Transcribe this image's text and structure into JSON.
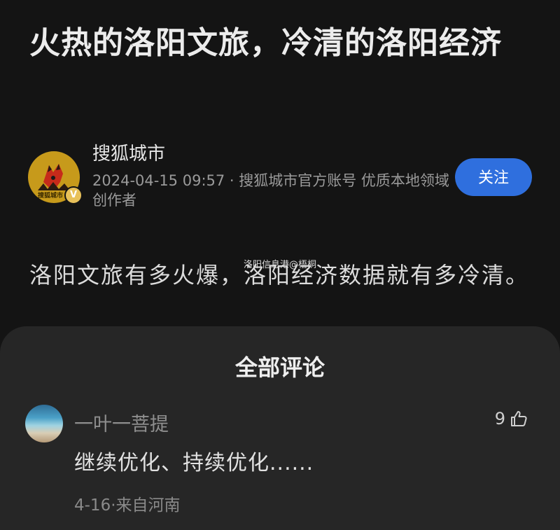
{
  "article": {
    "title": "火热的洛阳文旅，冷清的洛阳经济",
    "author": {
      "name": "搜狐城市",
      "avatar_text": "搜狐城市",
      "verified_mark": "V",
      "meta": "2024-04-15 09:57 · 搜狐城市官方账号 优质本地领域创作者"
    },
    "follow_label": "关注",
    "watermark": "洛阳信息港@梧桐",
    "body": "洛阳文旅有多火爆，洛阳经济数据就有多冷清。"
  },
  "comments_sheet": {
    "title": "全部评论",
    "comments": [
      {
        "user": "一叶一菩提",
        "likes": "9",
        "text": "继续优化、持续优化......",
        "meta": "4-16·来自河南"
      }
    ]
  },
  "colors": {
    "background": "#141414",
    "sheet": "#262626",
    "accent": "#2f6fde",
    "avatar_brand": "#c79a1b"
  },
  "icons": {
    "like": "thumbs-up-icon",
    "verified": "verified-badge-icon",
    "avatar": "fox-logo-icon"
  }
}
